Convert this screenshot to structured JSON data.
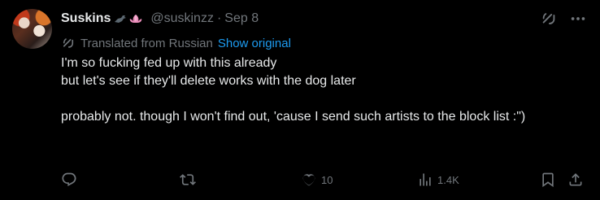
{
  "tweet": {
    "display_name": "Suskins",
    "badge_emojis": "🐦‍⬛🪷",
    "handle": "@suskinzz",
    "separator": "·",
    "date": "Sep 8",
    "translation": {
      "label": "Translated from Russian",
      "show_original": "Show original"
    },
    "text": {
      "line1": "I'm so fucking fed up with this already",
      "line2": "but let's see if they'll delete works with the dog later",
      "line3": "probably not. though I won't find out, 'cause I send such artists to the block list :\")"
    },
    "metrics": {
      "likes": "10",
      "views": "1.4K"
    }
  },
  "icons": {
    "reply": "reply-icon",
    "retweet": "retweet-icon",
    "like": "heart-icon",
    "views": "views-icon",
    "bookmark": "bookmark-icon",
    "share": "share-icon",
    "grok": "grok-icon",
    "more": "more-icon",
    "translate": "translate-icon"
  },
  "colors": {
    "background": "#000000",
    "text": "#e7e9ea",
    "muted": "#71767b",
    "link": "#1d9bf0"
  }
}
